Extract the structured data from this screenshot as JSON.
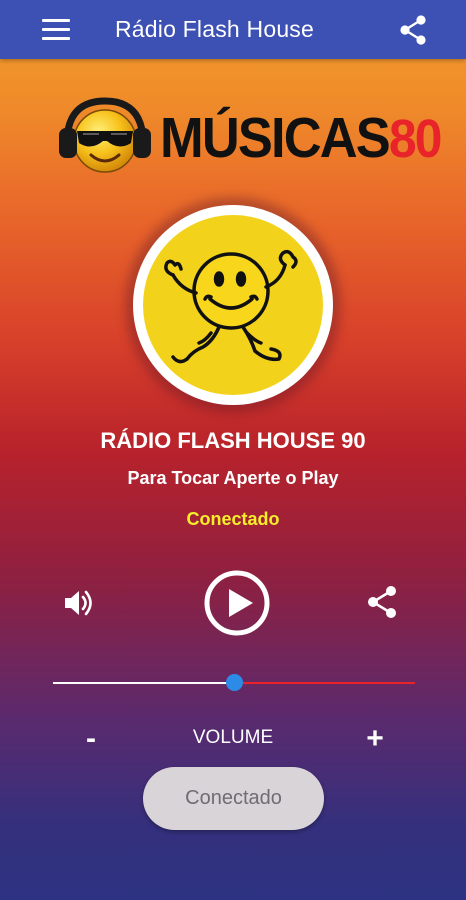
{
  "appbar": {
    "title": "Rádio Flash House",
    "menu_icon": "menu-icon",
    "share_icon": "share-icon"
  },
  "logo": {
    "text_main": "MÚSICAS",
    "text_num": "80"
  },
  "station": {
    "name": "RÁDIO FLASH HOUSE 90",
    "subtitle": "Para Tocar Aperte o Play",
    "status": "Conectado",
    "artwork_icon": "dancing-smiley-icon"
  },
  "controls": {
    "volume_icon": "volume-icon",
    "play_icon": "play-icon",
    "share_icon": "share-icon"
  },
  "volume": {
    "level": 0.5,
    "label": "VOLUME",
    "minus": "-",
    "plus": "+"
  },
  "connect_button": {
    "label": "Conectado"
  },
  "colors": {
    "appbar": "#3d50b3",
    "status": "#f6ee2a",
    "slider_filled": "#ffffff",
    "slider_rest": "#e8232a",
    "slider_thumb": "#2d8be8"
  }
}
